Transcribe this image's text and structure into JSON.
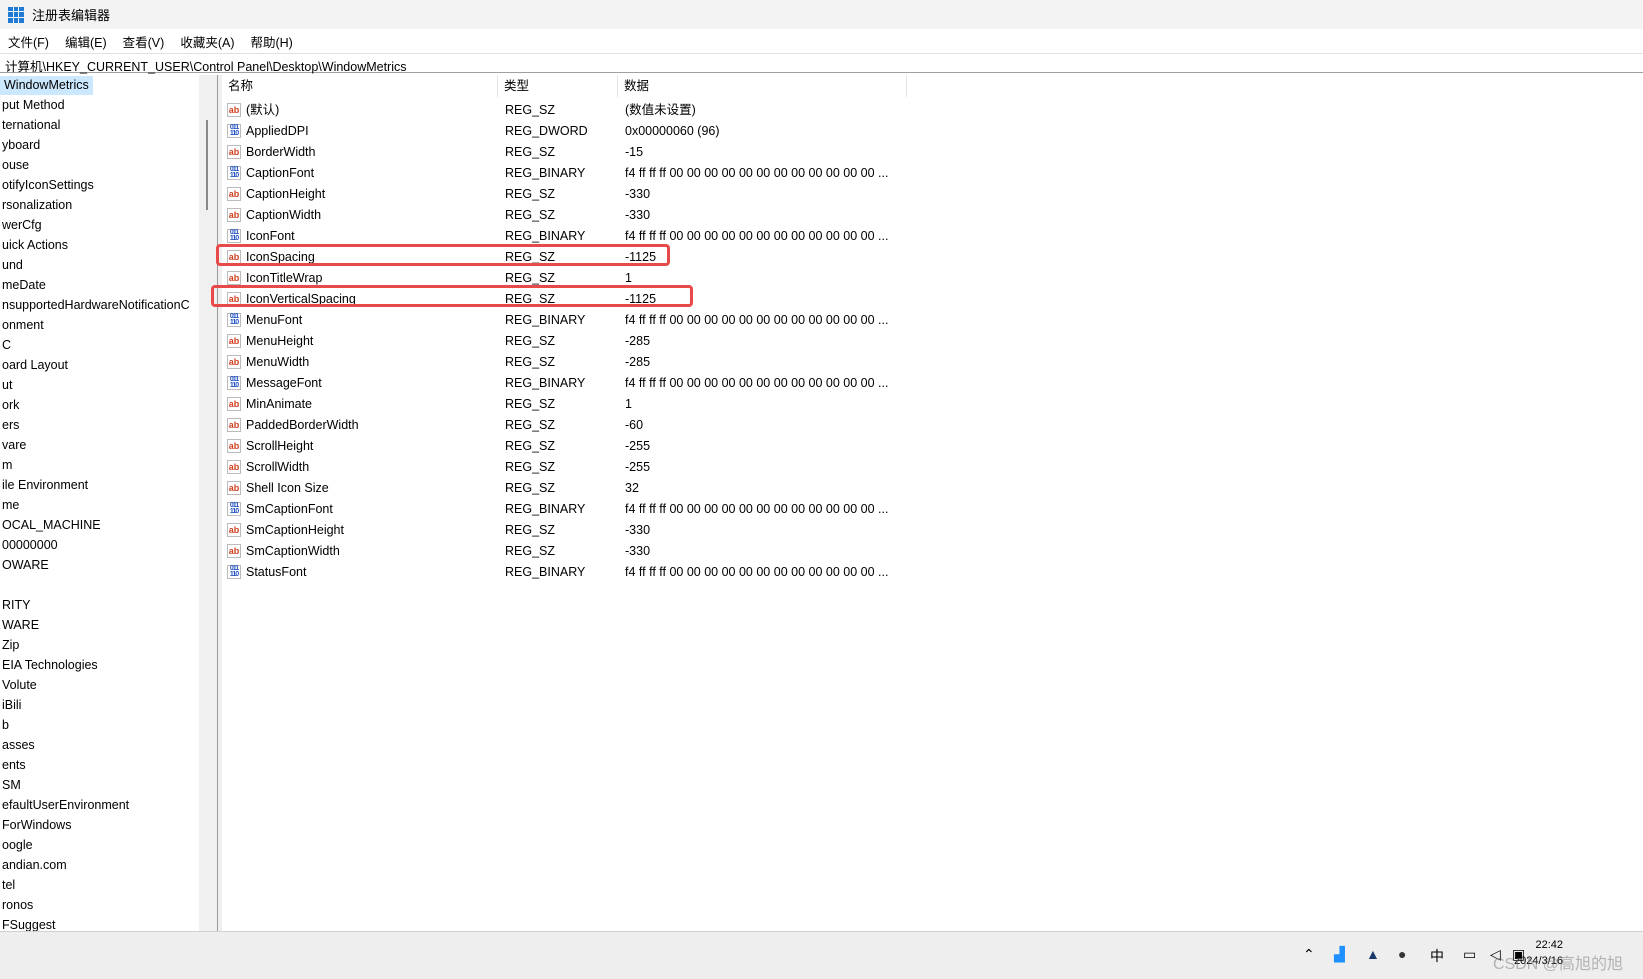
{
  "window": {
    "title": "注册表编辑器",
    "icon": "registry-editor-icon"
  },
  "menu": [
    "文件(F)",
    "编辑(E)",
    "查看(V)",
    "收藏夹(A)",
    "帮助(H)"
  ],
  "address": "计算机\\HKEY_CURRENT_USER\\Control Panel\\Desktop\\WindowMetrics",
  "tree": [
    "WindowMetrics",
    "put Method",
    "ternational",
    "yboard",
    "ouse",
    "otifyIconSettings",
    "rsonalization",
    "werCfg",
    "uick Actions",
    "und",
    "meDate",
    "nsupportedHardwareNotificationC",
    "onment",
    "C",
    "oard Layout",
    "ut",
    "ork",
    "ers",
    "vare",
    "m",
    "ile Environment",
    "me",
    "OCAL_MACHINE",
    "00000000",
    "OWARE",
    "",
    "RITY",
    "WARE",
    "Zip",
    "EIA Technologies",
    "Volute",
    "iBili",
    "b",
    "asses",
    "ents",
    "SM",
    "efaultUserEnvironment",
    "ForWindows",
    "oogle",
    "andian.com",
    "tel",
    "ronos",
    "FSuggest"
  ],
  "columns": [
    "名称",
    "类型",
    "数据"
  ],
  "values": [
    {
      "icon": "sz",
      "name": "(默认)",
      "type": "REG_SZ",
      "data": "(数值未设置)"
    },
    {
      "icon": "bin",
      "name": "AppliedDPI",
      "type": "REG_DWORD",
      "data": "0x00000060 (96)"
    },
    {
      "icon": "sz",
      "name": "BorderWidth",
      "type": "REG_SZ",
      "data": "-15"
    },
    {
      "icon": "bin",
      "name": "CaptionFont",
      "type": "REG_BINARY",
      "data": "f4 ff ff ff 00 00 00 00 00 00 00 00 00 00 00 00 ..."
    },
    {
      "icon": "sz",
      "name": "CaptionHeight",
      "type": "REG_SZ",
      "data": "-330"
    },
    {
      "icon": "sz",
      "name": "CaptionWidth",
      "type": "REG_SZ",
      "data": "-330"
    },
    {
      "icon": "bin",
      "name": "IconFont",
      "type": "REG_BINARY",
      "data": "f4 ff ff ff 00 00 00 00 00 00 00 00 00 00 00 00 ..."
    },
    {
      "icon": "sz",
      "name": "IconSpacing",
      "type": "REG_SZ",
      "data": "-1125"
    },
    {
      "icon": "sz",
      "name": "IconTitleWrap",
      "type": "REG_SZ",
      "data": "1"
    },
    {
      "icon": "sz",
      "name": "IconVerticalSpacing",
      "type": "REG_SZ",
      "data": "-1125"
    },
    {
      "icon": "bin",
      "name": "MenuFont",
      "type": "REG_BINARY",
      "data": "f4 ff ff ff 00 00 00 00 00 00 00 00 00 00 00 00 ..."
    },
    {
      "icon": "sz",
      "name": "MenuHeight",
      "type": "REG_SZ",
      "data": "-285"
    },
    {
      "icon": "sz",
      "name": "MenuWidth",
      "type": "REG_SZ",
      "data": "-285"
    },
    {
      "icon": "bin",
      "name": "MessageFont",
      "type": "REG_BINARY",
      "data": "f4 ff ff ff 00 00 00 00 00 00 00 00 00 00 00 00 ..."
    },
    {
      "icon": "sz",
      "name": "MinAnimate",
      "type": "REG_SZ",
      "data": "1"
    },
    {
      "icon": "sz",
      "name": "PaddedBorderWidth",
      "type": "REG_SZ",
      "data": "-60"
    },
    {
      "icon": "sz",
      "name": "ScrollHeight",
      "type": "REG_SZ",
      "data": "-255"
    },
    {
      "icon": "sz",
      "name": "ScrollWidth",
      "type": "REG_SZ",
      "data": "-255"
    },
    {
      "icon": "sz",
      "name": "Shell Icon Size",
      "type": "REG_SZ",
      "data": "32"
    },
    {
      "icon": "bin",
      "name": "SmCaptionFont",
      "type": "REG_BINARY",
      "data": "f4 ff ff ff 00 00 00 00 00 00 00 00 00 00 00 00 ..."
    },
    {
      "icon": "sz",
      "name": "SmCaptionHeight",
      "type": "REG_SZ",
      "data": "-330"
    },
    {
      "icon": "sz",
      "name": "SmCaptionWidth",
      "type": "REG_SZ",
      "data": "-330"
    },
    {
      "icon": "bin",
      "name": "StatusFont",
      "type": "REG_BINARY",
      "data": "f4 ff ff ff 00 00 00 00 00 00 00 00 00 00 00 00 ..."
    }
  ],
  "highlight_color": "#e84a4a",
  "taskbar": {
    "ime": "中",
    "time": "22:42",
    "date": "2024/3/16",
    "watermark": "CSDN @高旭的旭"
  }
}
